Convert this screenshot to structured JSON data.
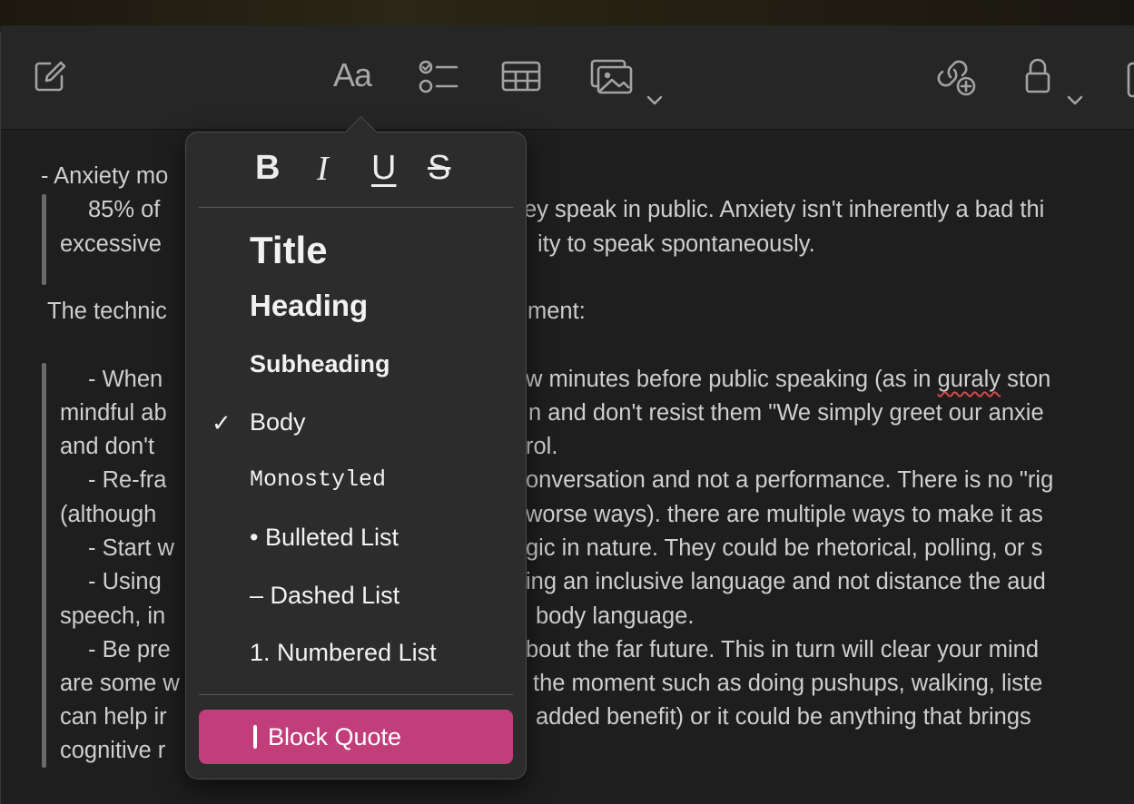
{
  "toolbar": {
    "icons": [
      "compose-icon",
      "format-icon",
      "checklist-icon",
      "table-icon",
      "media-icon",
      "collaborate-icon",
      "lock-icon"
    ],
    "format_label": "Aa"
  },
  "note": {
    "lines": [
      "- Anxiety mo",
      "85% of",
      "ey speak in public. Anxiety isn't inherently a bad thi",
      "excessive",
      "ity to speak spontaneously.",
      "The technic",
      "ment:",
      "- When",
      "w minutes before public speaking (as in ",
      "guraly",
      " ston",
      "mindful ab",
      "n and don't resist them \"We simply greet our anxie",
      "and don't",
      "rol.",
      "- Re-fra",
      "onversation and not a performance. There is no \"rig",
      "(although",
      "worse ways). there are multiple ways to make it as",
      "- Start w",
      "gic in nature. They could be rhetorical, polling, or s",
      "- Using",
      "ing an inclusive language and not distance the aud",
      "speech, in",
      "body language.",
      "- Be pre",
      "bout the far future. This in turn will clear your mind",
      "are some w",
      "the moment such as doing pushups, walking, liste",
      "can help ir",
      "added benefit) or it could be anything that brings",
      "cognitive r"
    ]
  },
  "popover": {
    "format": {
      "bold": "B",
      "italic": "I",
      "underline": "U",
      "strike": "S"
    },
    "styles": {
      "title": "Title",
      "heading": "Heading",
      "subheading": "Subheading",
      "body": "Body",
      "mono": "Monostyled",
      "bulleted": "• Bulleted List",
      "dashed": "– Dashed List",
      "numbered": "1. Numbered List",
      "blockquote": "Block Quote"
    },
    "checked": "✓",
    "selected_style": "Body",
    "accent_color": "#c23e7b"
  }
}
